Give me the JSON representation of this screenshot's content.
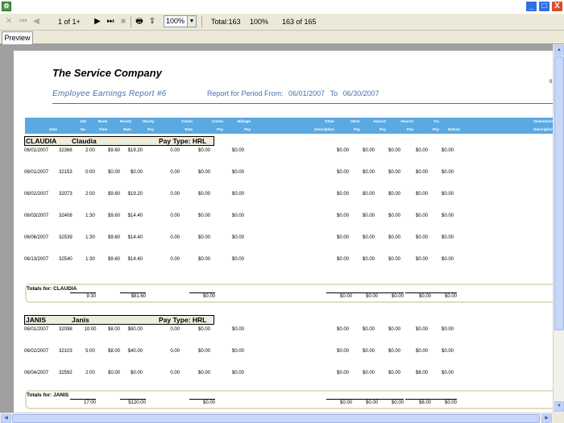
{
  "window": {
    "icon": "app-icon",
    "minimize": "_",
    "maximize": "□",
    "close": "X"
  },
  "toolbar": {
    "page_info": "1 of 1+",
    "zoom": "100%",
    "total": "Total:163",
    "percent": "100%",
    "records": "163 of 165"
  },
  "tabs": [
    {
      "label": "Preview"
    }
  ],
  "report": {
    "company": "The Service Company",
    "title": "Employee Earnings Report #6",
    "period_label": "Report for Period From:",
    "period_from": "06/01/2007",
    "period_to_label": "To",
    "period_to": "06/30/2007",
    "corner": "0",
    "headers": {
      "date": [
        "",
        "Date"
      ],
      "job": [
        "Job",
        "No."
      ],
      "book": [
        "Book",
        "Time"
      ],
      "hourly_rate": [
        "Hourly",
        "Rate"
      ],
      "hourly_pay": [
        "Hourly",
        "Pay"
      ],
      "comm_rate": [
        "Comm",
        "Rate"
      ],
      "comm_pay": [
        "Comm",
        "Pay"
      ],
      "mileage": [
        "Mileage",
        "Pay"
      ],
      "other_desc": [
        "Other",
        "Description"
      ],
      "other_pay": [
        "Other",
        "Pay"
      ],
      "hours2": [
        "Hours2",
        "Pay"
      ],
      "hours3": [
        "Hours3",
        "Pay"
      ],
      "fix": [
        "Fix",
        "Pay"
      ],
      "deduct": [
        "",
        "Deduct"
      ],
      "ded_desc": [
        "Deductions",
        "Description"
      ]
    },
    "groups": [
      {
        "code": "CLAUDIA",
        "name": "Claudia",
        "paytype": "Pay Type: HRL",
        "rows": [
          [
            "06/01/2007",
            "32366",
            "2:00",
            "$9.60",
            "$19.20",
            "0.00",
            "$0.00",
            "$0.00",
            "$0.00",
            "$0.00",
            "$0.00",
            "$0.00",
            "$0.00"
          ],
          [
            "06/01/2007",
            "32153",
            "0:00",
            "$0.00",
            "$0.00",
            "0.00",
            "$0.00",
            "$0.00",
            "$0.00",
            "$0.00",
            "$0.00",
            "$0.00",
            "$0.00"
          ],
          [
            "06/02/2007",
            "32073",
            "2:00",
            "$9.60",
            "$19.20",
            "0.00",
            "$0.00",
            "$0.00",
            "$0.00",
            "$0.00",
            "$0.00",
            "$0.00",
            "$0.00"
          ],
          [
            "06/03/2007",
            "32408",
            "1:30",
            "$9.60",
            "$14.40",
            "0.00",
            "$0.00",
            "$0.00",
            "$0.00",
            "$0.00",
            "$0.00",
            "$0.00",
            "$0.00"
          ],
          [
            "06/06/2007",
            "32539",
            "1:30",
            "$9.60",
            "$14.40",
            "0.00",
            "$0.00",
            "$0.00",
            "$0.00",
            "$0.00",
            "$0.00",
            "$0.00",
            "$0.00"
          ],
          [
            "06/13/2007",
            "32540",
            "1:30",
            "$9.60",
            "$14.40",
            "0.00",
            "$0.00",
            "$0.00",
            "$0.00",
            "$0.00",
            "$0.00",
            "$0.00",
            "$0.00"
          ]
        ],
        "totals": {
          "label": "Totals for:  CLAUDIA",
          "time": "9:30",
          "hourly_pay": "$81.60",
          "comm_pay": "$0.00",
          "other": "$0.00",
          "h2": "$0.00",
          "h3": "$0.00",
          "fix": "$0.00",
          "deduct": "$0.00"
        }
      },
      {
        "code": "JANIS",
        "name": "Janis",
        "paytype": "Pay Type: HRL",
        "rows": [
          [
            "06/01/2007",
            "32098",
            "10:00",
            "$8.00",
            "$80.00",
            "0.00",
            "$0.00",
            "$0.00",
            "$0.00",
            "$0.00",
            "$0.00",
            "$0.00",
            "$0.00"
          ],
          [
            "06/02/2007",
            "32103",
            "5:00",
            "$8.00",
            "$40.00",
            "0.00",
            "$0.00",
            "$0.00",
            "$0.00",
            "$0.00",
            "$0.00",
            "$0.00",
            "$0.00"
          ],
          [
            "06/04/2007",
            "32592",
            "2:00",
            "$0.00",
            "$0.00",
            "0.00",
            "$0.00",
            "$0.00",
            "$0.00",
            "$0.00",
            "$0.00",
            "$8.00",
            "$0.00"
          ]
        ],
        "totals": {
          "label": "Totals for:  JANIS",
          "time": "17:00",
          "hourly_pay": "$120.00",
          "comm_pay": "$0.00",
          "other": "$0.00",
          "h2": "$0.00",
          "h3": "$0.00",
          "fix": "$8.00",
          "deduct": "$0.00"
        }
      }
    ]
  }
}
